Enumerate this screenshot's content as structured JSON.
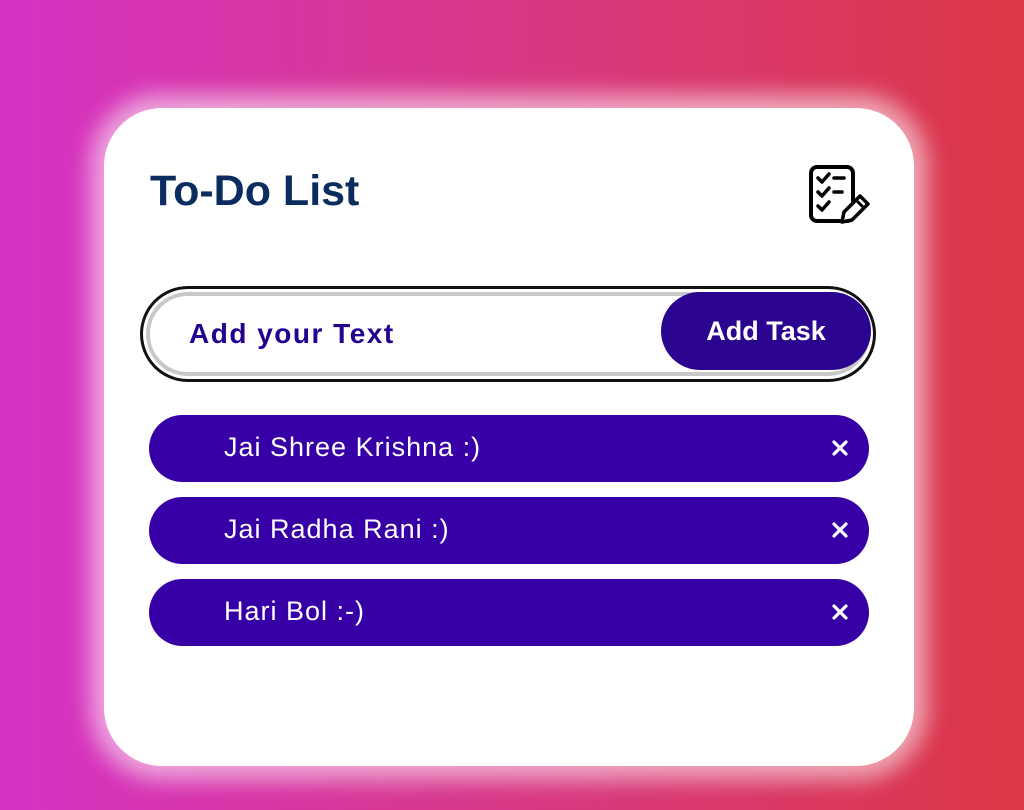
{
  "app": {
    "title": "To-Do List",
    "title_icon": "checklist-edit-icon"
  },
  "input": {
    "placeholder": "Add your Text",
    "value": ""
  },
  "add_button": {
    "label": "Add Task"
  },
  "tasks": [
    {
      "text": "Jai Shree Krishna :)",
      "remove_icon": "close-icon"
    },
    {
      "text": "Jai Radha Rani :)",
      "remove_icon": "close-icon"
    },
    {
      "text": "Hari Bol :-)",
      "remove_icon": "close-icon"
    }
  ],
  "colors": {
    "gradient_start": "#d633c6",
    "gradient_end": "#db3744",
    "title": "#0a2c5e",
    "accent": "#2b048f",
    "task_bg": "#3700a6"
  }
}
